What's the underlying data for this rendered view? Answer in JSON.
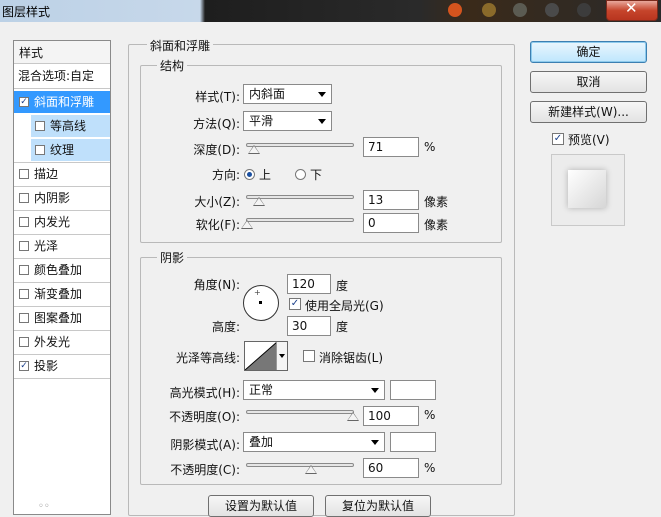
{
  "window": {
    "title": "图层样式",
    "close_symbol": "✕"
  },
  "left_panel": {
    "header": "样式",
    "blend_options": "混合选项:自定",
    "items": [
      {
        "label": "斜面和浮雕",
        "checked": true,
        "selected": true
      },
      {
        "label": "等高线",
        "checked": false,
        "sub": true
      },
      {
        "label": "纹理",
        "checked": false,
        "sub": true
      },
      {
        "label": "描边",
        "checked": false
      },
      {
        "label": "内阴影",
        "checked": false
      },
      {
        "label": "内发光",
        "checked": false
      },
      {
        "label": "光泽",
        "checked": false
      },
      {
        "label": "颜色叠加",
        "checked": false
      },
      {
        "label": "渐变叠加",
        "checked": false
      },
      {
        "label": "图案叠加",
        "checked": false
      },
      {
        "label": "外发光",
        "checked": false
      },
      {
        "label": "投影",
        "checked": true
      }
    ]
  },
  "bevel": {
    "group_title": "斜面和浮雕",
    "structure_title": "结构",
    "style_label": "样式(T):",
    "style_value": "内斜面",
    "technique_label": "方法(Q):",
    "technique_value": "平滑",
    "depth_label": "深度(D):",
    "depth_value": "71",
    "depth_unit": "%",
    "depth_pct": 0.04,
    "direction_label": "方向:",
    "dir_up": "上",
    "dir_down": "下",
    "size_label": "大小(Z):",
    "size_value": "13",
    "size_unit": "像素",
    "soften_label": "软化(F):",
    "soften_value": "0",
    "soften_unit": "像素"
  },
  "shading": {
    "title": "阴影",
    "angle_label": "角度(N):",
    "angle_value": "120",
    "angle_unit": "度",
    "global_light_label": "使用全局光(G)",
    "global_light_checked": true,
    "altitude_label": "高度:",
    "altitude_value": "30",
    "altitude_unit": "度",
    "gloss_label": "光泽等高线:",
    "antialias_label": "消除锯齿(L)",
    "antialias_checked": false,
    "highlight_mode_label": "高光模式(H):",
    "highlight_mode_value": "正常",
    "highlight_color": "#ffffff",
    "highlight_opacity_label": "不透明度(O):",
    "highlight_opacity_value": "100",
    "highlight_opacity_unit": "%",
    "shadow_mode_label": "阴影模式(A):",
    "shadow_mode_value": "叠加",
    "shadow_color": "#ffffff",
    "shadow_opacity_label": "不透明度(C):",
    "shadow_opacity_value": "60",
    "shadow_opacity_unit": "%"
  },
  "buttons": {
    "ok": "确定",
    "cancel": "取消",
    "new_style": "新建样式(W)...",
    "preview_label": "预览(V)",
    "preview_checked": true,
    "make_default": "设置为默认值",
    "reset_default": "复位为默认值"
  }
}
